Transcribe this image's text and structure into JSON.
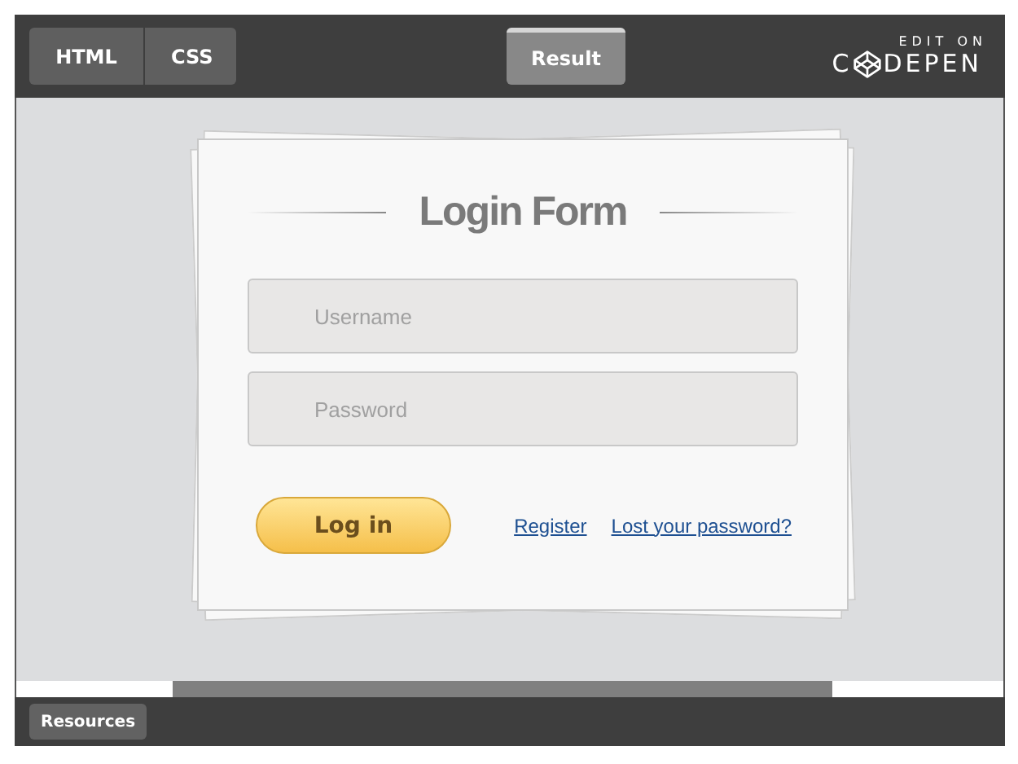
{
  "tabs": [
    {
      "label": "HTML",
      "selected": false
    },
    {
      "label": "CSS",
      "selected": false
    }
  ],
  "result_tab": {
    "label": "Result",
    "selected": true
  },
  "logo": {
    "top": "EDIT ON",
    "left": "C",
    "right": "DEPEN"
  },
  "form": {
    "title": "Login Form",
    "fields": [
      {
        "placeholder": "Username"
      },
      {
        "placeholder": "Password"
      }
    ],
    "button": "Log in",
    "links": [
      "Register",
      "Lost your password?"
    ]
  },
  "footer": {
    "button": "Resources"
  }
}
